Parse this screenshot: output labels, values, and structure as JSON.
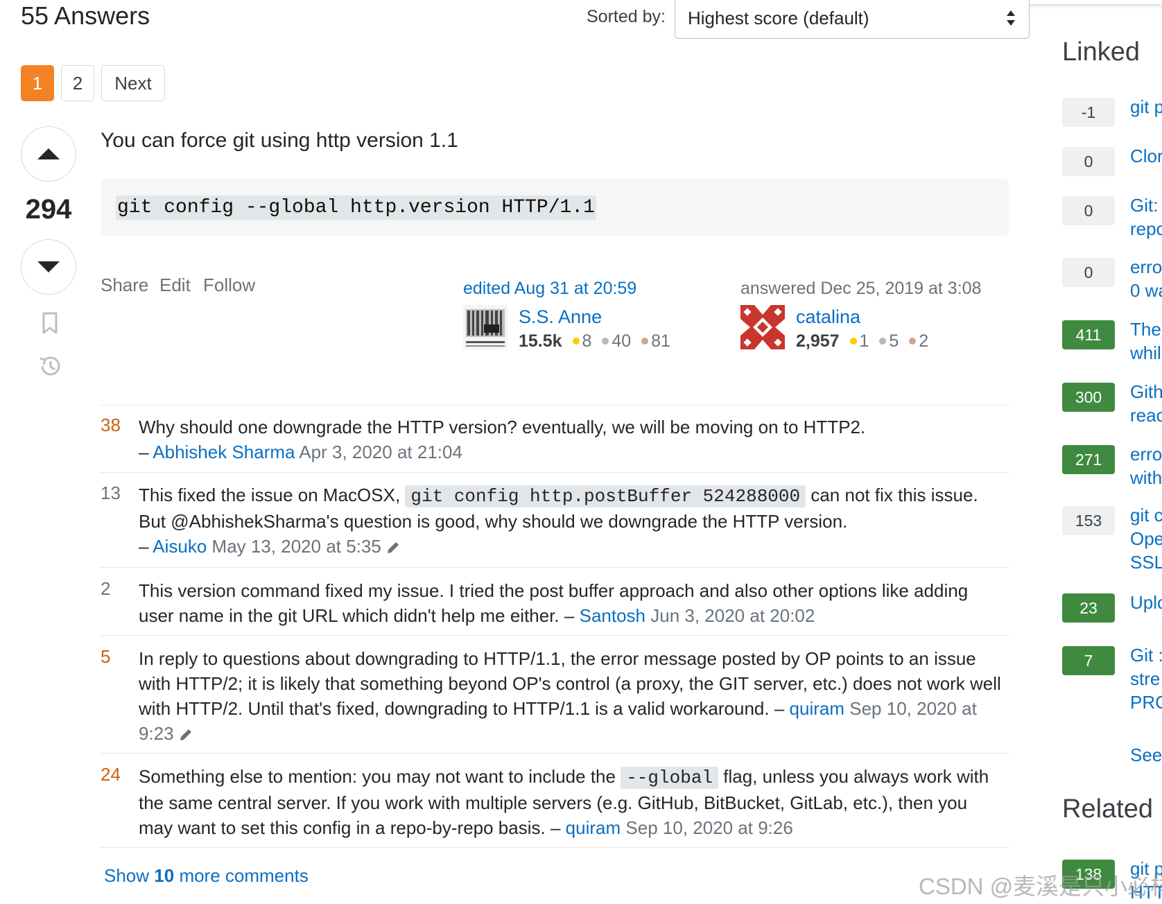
{
  "header": {
    "answers_count": "55 Answers",
    "sort_label": "Sorted by:",
    "sort_value": "Highest score (default)"
  },
  "pagination": {
    "pages": [
      "1",
      "2"
    ],
    "next_label": "Next",
    "current": "1"
  },
  "answer": {
    "score": "294",
    "text": "You can force git using http version 1.1",
    "code": "git config --global http.version HTTP/1.1",
    "menu": {
      "share": "Share",
      "edit": "Edit",
      "follow": "Follow"
    },
    "editor": {
      "action": "edited Aug 31 at 20:59",
      "name": "S.S. Anne",
      "rep": "15.5k",
      "gold": "8",
      "silver": "40",
      "bronze": "81"
    },
    "author": {
      "action": "answered Dec 25, 2019 at 3:08",
      "name": "catalina",
      "rep": "2,957",
      "gold": "1",
      "silver": "5",
      "bronze": "2"
    }
  },
  "comments": [
    {
      "score": "38",
      "text": "Why should one downgrade the HTTP version? eventually, we will be moving on to HTTP2.",
      "user": "Abhishek Sharma",
      "date": "Apr 3, 2020 at 21:04"
    },
    {
      "score": "13",
      "text_before": "This fixed the issue on MacOSX,",
      "code": "git config http.postBuffer 524288000",
      "text_after": "can not fix this issue. But @AbhishekSharma's question is good, why should we downgrade the HTTP version.",
      "user": "Aisuko",
      "date": "May 13, 2020 at 5:35"
    },
    {
      "score": "2",
      "text": "This version command fixed my issue. I tried the post buffer approach and also other options like adding user name in the git URL which didn't help me either.",
      "user": "Santosh",
      "date": "Jun 3, 2020 at 20:02"
    },
    {
      "score": "5",
      "text": "In reply to questions about downgrading to HTTP/1.1, the error message posted by OP points to an issue with HTTP/2; it is likely that something beyond OP's control (a proxy, the GIT server, etc.) does not work well with HTTP/2. Until that's fixed, downgrading to HTTP/1.1 is a valid workaround.",
      "user": "quiram",
      "date": "Sep 10, 2020 at 9:23"
    },
    {
      "score": "24",
      "text_before": "Something else to mention: you may not want to include the",
      "code": "--global",
      "text_after": "flag, unless you always work with the same central server. If you work with multiple servers (e.g. GitHub, BitBucket, GitLab, etc.), then you may want to set this config in a repo-by-repo basis.",
      "user": "quiram",
      "date": "Sep 10, 2020 at 9:26"
    }
  ],
  "comments_dash": "–",
  "show_more": {
    "prefix": "Show",
    "count": "10",
    "suffix": "more comments"
  },
  "sidebar": {
    "linked_title": "Linked",
    "linked": [
      {
        "score": "-1",
        "accepted": false,
        "lines": [
          "git p"
        ]
      },
      {
        "score": "0",
        "accepted": false,
        "lines": [
          "Clor"
        ]
      },
      {
        "score": "0",
        "accepted": false,
        "lines": [
          "Git:",
          "repo"
        ]
      },
      {
        "score": "0",
        "accepted": false,
        "lines": [
          "erro",
          "0 wa"
        ]
      },
      {
        "score": "411",
        "accepted": true,
        "lines": [
          "The",
          "whil"
        ]
      },
      {
        "score": "300",
        "accepted": true,
        "lines": [
          "Gith",
          "reac"
        ]
      },
      {
        "score": "271",
        "accepted": true,
        "lines": [
          "erro",
          "with"
        ]
      },
      {
        "score": "153",
        "accepted": false,
        "lines": [
          "git c",
          "Ope",
          "SSL"
        ]
      },
      {
        "score": "23",
        "accepted": true,
        "lines": [
          "Uplc"
        ]
      },
      {
        "score": "7",
        "accepted": true,
        "lines": [
          "Git :",
          "stre",
          "PRC"
        ]
      }
    ],
    "see_more": "See",
    "related_title": "Related",
    "related_first": {
      "score": "138",
      "lines": [
        "git p",
        "HTT"
      ]
    }
  },
  "watermark": "CSDN @麦溪是只小必样"
}
